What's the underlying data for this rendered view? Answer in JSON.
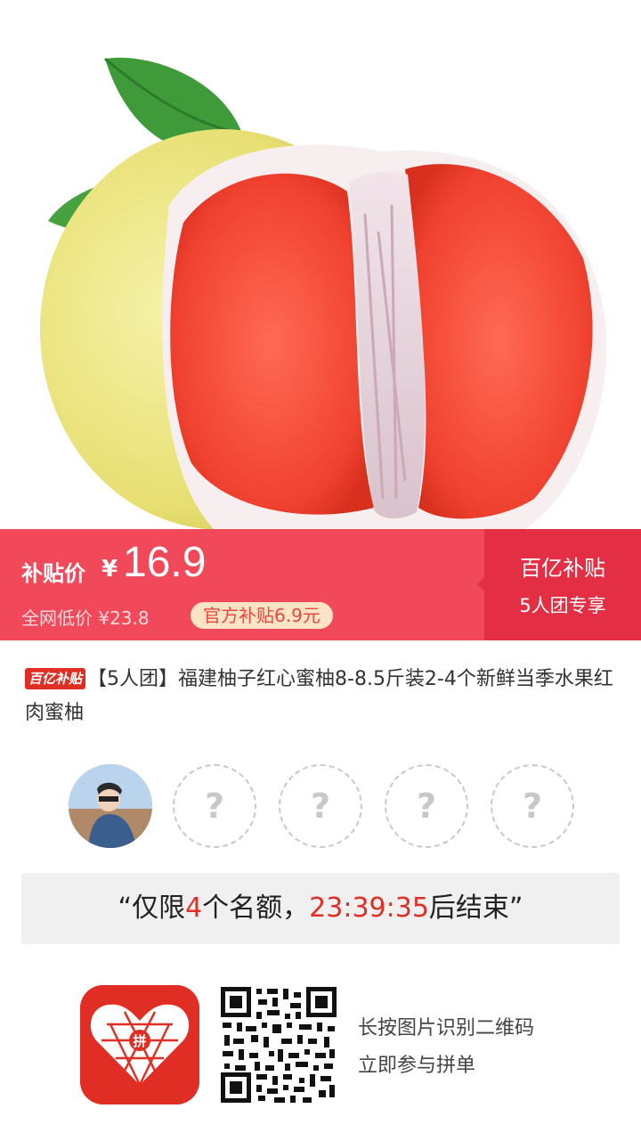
{
  "banner": {
    "price_label": "补贴价",
    "currency": "¥",
    "price": "16.9",
    "orig_price": "全网低价 ¥23.8",
    "subsidy_pill": "官方补贴6.9元",
    "badge_title": "百亿补贴",
    "badge_sub": "5人团专享"
  },
  "product": {
    "brand_tag": "百亿补贴",
    "title": "【5人团】福建柚子红心蜜柚8-8.5斤装2-4个新鲜当季水果红肉蜜柚"
  },
  "group": {
    "placeholder_glyph": "?",
    "slot_count": 5,
    "filled": 1
  },
  "countdown": {
    "prefix": "“仅限",
    "count": "4",
    "middle": "个名额，",
    "time": "23:39:35",
    "suffix": "后结束”"
  },
  "footer": {
    "hint_1": "长按图片识别二维码",
    "hint_2": "立即参与拼单",
    "logo_icon": "pinduoduo-logo-icon",
    "qr_icon": "qr-code-icon"
  },
  "colors": {
    "banner": "#f1485a",
    "banner_dark": "#e32e43",
    "accent_red": "#e02e24",
    "pill_bg": "#ffe3c6"
  }
}
